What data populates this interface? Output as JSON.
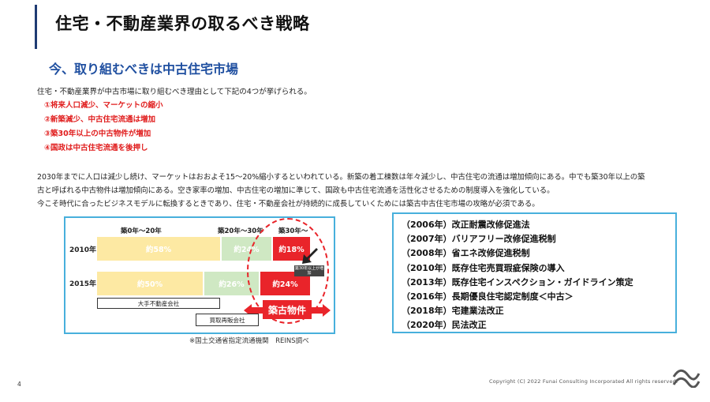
{
  "header": {
    "title": "住宅・不動産業界の取るべき戦略"
  },
  "subtitle": "今、取り組むべきは中古住宅市場",
  "intro": "住宅・不動産業界が中古市場に取り組むべき理由として下記の4つが挙げられる。",
  "reasons": [
    "①将来人口減少、マーケットの縮小",
    "②新築減少、中古住宅流通は増加",
    "③築30年以上の中古物件が増加",
    "④国政は中古住宅流通を後押し"
  ],
  "body_lines": [
    "2030年までに人口は減少し続け、マーケットはおおよそ15〜20%縮小するといわれている。新築の着工棟数は年々減少し、中古住宅の流通は増加傾向にある。中でも築30年以上の築",
    "古と呼ばれる中古物件は増加傾向にある。空き家率の増加、中古住宅の増加に準じて、国政も中古住宅流通を活性化させるための制度導入を強化している。",
    "今こそ時代に合ったビジネスモデルに転換するときであり、住宅・不動産会社が持続的に成長していくためには築古中古住宅市場の攻略が必須である。"
  ],
  "chart_data": {
    "type": "bar",
    "categories": [
      "2010年",
      "2015年"
    ],
    "column_headers": [
      "築0年〜20年",
      "築20年〜30年",
      "築30年〜"
    ],
    "series": [
      {
        "name": "築0年〜20年",
        "values": [
          58,
          50
        ],
        "labels": [
          "約58%",
          "約50%"
        ],
        "color": "#fde9a3"
      },
      {
        "name": "築20年〜30年",
        "values": [
          24,
          26
        ],
        "labels": [
          "約24%",
          "約26%"
        ],
        "color": "#cfe8c3"
      },
      {
        "name": "築30年〜",
        "values": [
          18,
          24
        ],
        "labels": [
          "約18%",
          "約24%"
        ],
        "color": "#e9242a"
      }
    ],
    "annotation_arrow": "築30年以上が増加",
    "highlight_label": "築古物件",
    "box_labels": [
      "大手不動産会社",
      "買取再販会社"
    ],
    "source": "※国土交通省指定流通機関　REINS調べ"
  },
  "laws": [
    "（2006年）改正耐震改修促進法",
    "（2007年）バリアフリー改修促進税制",
    "（2008年）省エネ改修促進税制",
    "（2010年）既存住宅売買瑕疵保険の導入",
    "（2013年）既存住宅インスペクション・ガイドライン策定",
    "（2016年）長期優良住宅認定制度＜中古＞",
    "（2018年）宅建業法改正",
    "（2020年）民法改正"
  ],
  "footer": {
    "page_number": "4",
    "copyright": "Copyright (C) 2022 Funai Consulting Incorporated All rights reserved."
  },
  "colors": {
    "accent": "#1f4fa0",
    "red": "#e9242a",
    "box_border": "#48b0dc"
  }
}
